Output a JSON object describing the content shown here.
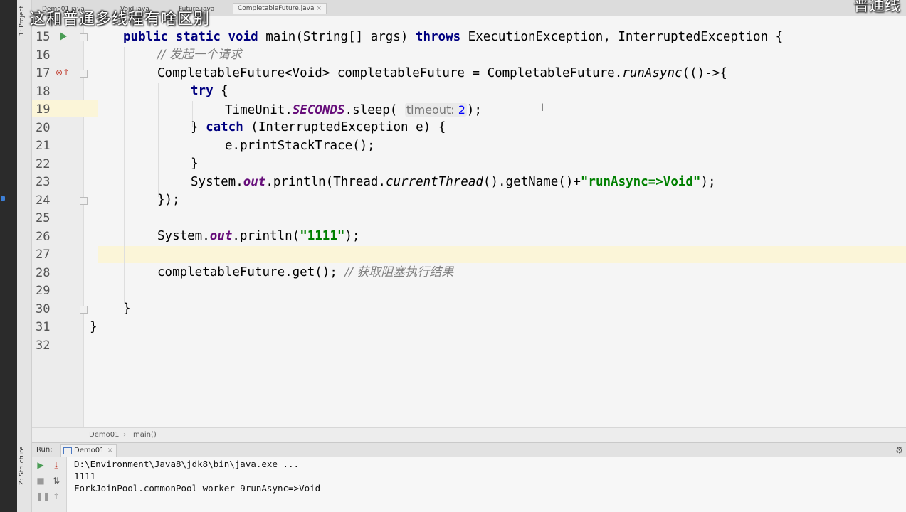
{
  "overlay": {
    "title": "这和普通多线程有啥区别",
    "right_fragment": "普通线"
  },
  "tool_rail": {
    "project_label": "1: Project",
    "structure_label": "Z: Structure"
  },
  "tabs": [
    {
      "label": "Demo01.java"
    },
    {
      "label": "Void.java"
    },
    {
      "label": "Future.java"
    },
    {
      "label": "CompletableFuture.java",
      "close": "×"
    }
  ],
  "editor": {
    "line_numbers": [
      "15",
      "16",
      "17",
      "18",
      "19",
      "20",
      "21",
      "22",
      "23",
      "24",
      "25",
      "26",
      "27",
      "28",
      "29",
      "30",
      "31",
      "32"
    ],
    "code": {
      "l15": {
        "kw1": "public static void",
        "t1": " main(String[] args) ",
        "kw2": "throws",
        "t2": " ExecutionException, InterruptedException {"
      },
      "l16": {
        "comment": "// 发起一个请求"
      },
      "l17": {
        "t1": "CompletableFuture<Void> completableFuture = CompletableFuture.",
        "it": "runAsync",
        "t2": "(()->{"
      },
      "l18": {
        "kw": "try",
        "t": " {"
      },
      "l19": {
        "t1": "TimeUnit.",
        "fld": "SECONDS",
        "t2": ".sleep( ",
        "hint": "timeout:",
        "num": "2",
        "t3": ");"
      },
      "l20": {
        "t1": "} ",
        "kw": "catch",
        "t2": " (InterruptedException e) {"
      },
      "l21": {
        "t": "e.printStackTrace();"
      },
      "l22": {
        "t": "}"
      },
      "l23": {
        "t1": "System.",
        "fld": "out",
        "t2": ".println(Thread.",
        "it": "currentThread",
        "t3": "().getName()+",
        "str": "\"runAsync=>Void\"",
        "t4": ");"
      },
      "l24": {
        "t": "});"
      },
      "l26": {
        "t1": "System.",
        "fld": "out",
        "t2": ".println(",
        "str": "\"1111\"",
        "t3": ");"
      },
      "l28": {
        "t1": "completableFuture.get(); ",
        "comment": "// 获取阻塞执行结果"
      },
      "l30": {
        "t": "}"
      },
      "l31": {
        "t": "}"
      }
    }
  },
  "breadcrumb": {
    "class_name": "Demo01",
    "separator": "›",
    "method": "main()"
  },
  "run_panel": {
    "label": "Run:",
    "tab": "Demo01",
    "tab_close": "×",
    "console_lines": [
      "D:\\Environment\\Java8\\jdk8\\bin\\java.exe ...",
      "1111",
      "ForkJoinPool.commonPool-worker-9runAsync=>Void"
    ]
  }
}
